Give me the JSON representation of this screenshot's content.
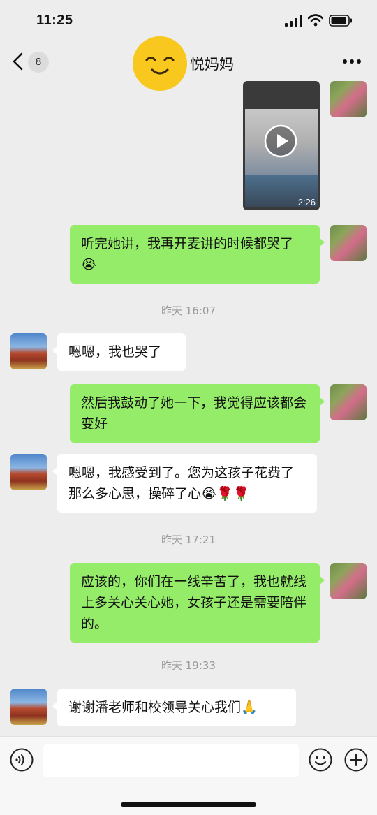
{
  "status_bar": {
    "time": "11:25"
  },
  "nav": {
    "unread_count": "8",
    "title": "悦妈妈",
    "back_icon": "chevron-left-icon",
    "more_icon": "more-dots-icon"
  },
  "messages": {
    "video": {
      "duration": "2:26"
    },
    "m1": "听完她讲，我再开麦讲的时候都哭了😭",
    "t1": "昨天 16:07",
    "m2": "嗯嗯，我也哭了",
    "m3": "然后我鼓动了她一下，我觉得应该都会变好",
    "m4": "嗯嗯，我感受到了。您为这孩子花费了那么多心思，操碎了心😭🌹🌹",
    "t2": "昨天 17:21",
    "m5": "应该的，你们在一线辛苦了，我也就线上多关心关心她，女孩子还是需要陪伴的。",
    "t3": "昨天 19:33",
    "m6": "谢谢潘老师和校领导关心我们🙏"
  },
  "input_bar": {
    "placeholder": "",
    "voice_icon": "voice-icon",
    "emoji_icon": "emoji-icon",
    "plus_icon": "plus-icon"
  },
  "colors": {
    "background": "#ededed",
    "my_bubble": "#95ec69",
    "other_bubble": "#ffffff",
    "timestamp": "#9a9a9a"
  }
}
